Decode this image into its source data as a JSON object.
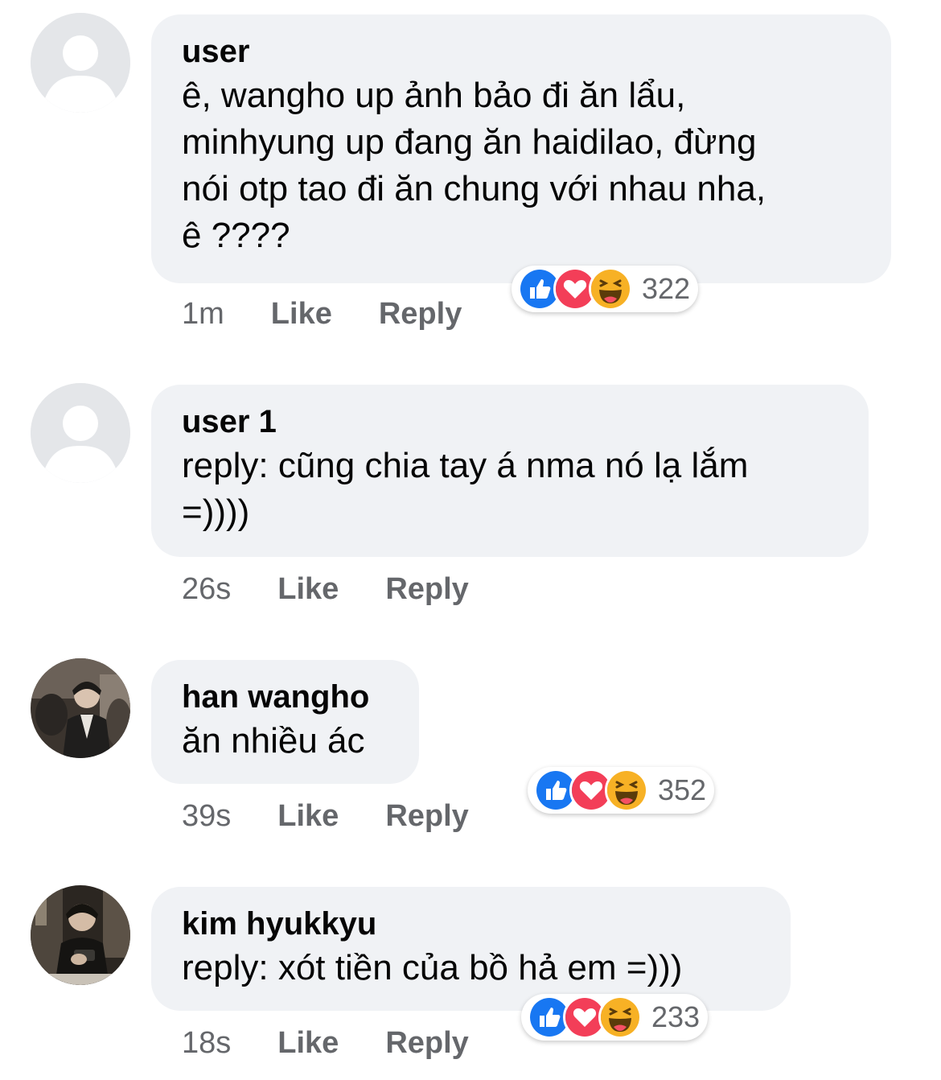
{
  "comments": [
    {
      "name": "user",
      "lines": [
        "ê, wangho up ảnh bảo đi ăn lẩu,",
        "minhyung up đang ăn haidilao, đừng",
        "nói otp tao đi ăn chung với nhau nha,",
        "ê ????"
      ],
      "time": "1m",
      "like": "Like",
      "reply": "Reply",
      "reactions": [
        "like-icon",
        "love-icon",
        "haha-icon"
      ],
      "reaction_count": "322"
    },
    {
      "name": "user 1",
      "lines": [
        "reply: cũng chia tay á nma nó lạ lắm",
        "=))))"
      ],
      "time": "26s",
      "like": "Like",
      "reply": "Reply"
    },
    {
      "name": "han wangho",
      "lines": [
        "ăn nhiều ác"
      ],
      "time": "39s",
      "like": "Like",
      "reply": "Reply",
      "reactions": [
        "like-icon",
        "love-icon",
        "haha-icon"
      ],
      "reaction_count": "352"
    },
    {
      "name": "kim hyukkyu",
      "lines": [
        "reply: xót tiền của bồ hả em =)))"
      ],
      "time": "18s",
      "like": "Like",
      "reply": "Reply",
      "reactions": [
        "like-icon",
        "love-icon",
        "haha-icon"
      ],
      "reaction_count": "233"
    }
  ],
  "colors": {
    "bubble": "#f0f2f5",
    "meta_text": "#65676b",
    "like": "#1877f2",
    "love": "#f33e58",
    "haha": "#f7b125"
  }
}
